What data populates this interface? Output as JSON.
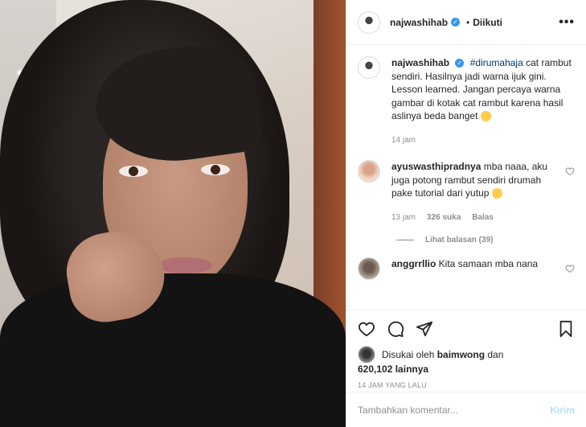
{
  "header": {
    "username": "najwashihab",
    "separator": "•",
    "follow_status": "Diikuti",
    "more": "•••"
  },
  "caption": {
    "username": "najwashihab",
    "hashtag": "#dirumahaja",
    "text": " cat rambut sendiri. Hasilnya jadi warna ijuk gini. Lesson learned. Jangan percaya warna gambar di kotak cat rambut karena hasil aslinya beda banget",
    "time": "14 jam"
  },
  "comments": [
    {
      "username": "ayuswasthipradnya",
      "text": " mba naaa, aku juga potong rambut sendiri drumah pake tutorial dari yutup",
      "time": "13 jam",
      "likes": "326 suka",
      "reply": "Balas",
      "view_replies": "Lihat balasan (39)"
    },
    {
      "username": "anggrrllio",
      "text": " Kita samaan mba nana"
    }
  ],
  "actions": {
    "liked_by_prefix": "Disukai oleh ",
    "liked_by_user": "baimwong",
    "liked_by_suffix": " dan",
    "likes_count": "620,102",
    "likes_others": " lainnya",
    "timestamp": "14 JAM YANG LALU"
  },
  "add_comment": {
    "placeholder": "Tambahkan komentar...",
    "post_label": "Kirim"
  },
  "colors": {
    "accent": "#3897f0",
    "hashtag": "#00376b",
    "muted": "#8e8e8e",
    "post_disabled": "#b2dffc"
  }
}
